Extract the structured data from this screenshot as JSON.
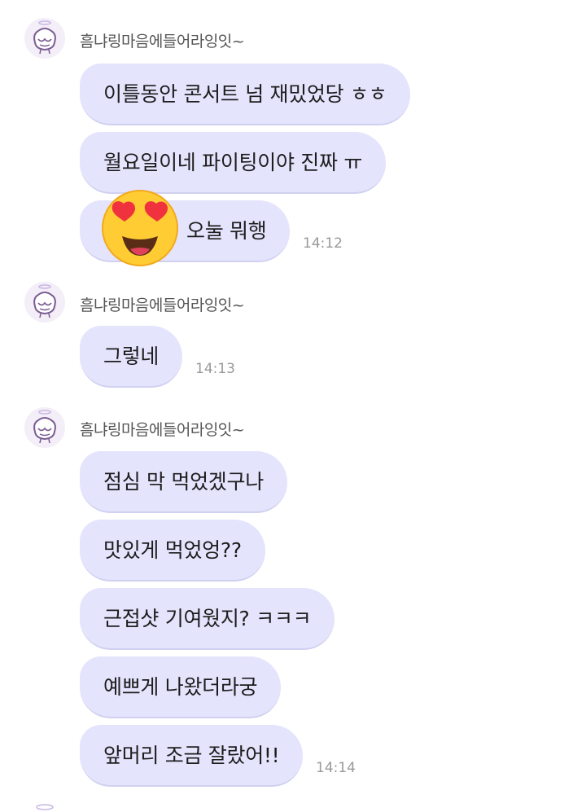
{
  "groups": [
    {
      "sender": "흠냐링마음에들어라잉잇~",
      "messages": [
        "이틀동안 콘서트 넘 재밌었당 ㅎㅎ",
        "월요일이네 파이팅이야 진짜 ㅠ",
        "오눌 뭐행"
      ],
      "time": "14:12"
    },
    {
      "sender": "흠냐링마음에들어라잉잇~",
      "messages": [
        "그렇네"
      ],
      "time": "14:13"
    },
    {
      "sender": "흠냐링마음에들어라잉잇~",
      "messages": [
        "점심 막 먹었겠구나",
        "맛있게 먹었엉??",
        "근접샷 기여웠지? ㅋㅋㅋ",
        "예쁘게 나왔더라궁",
        "앞머리 조금 잘랐어!!"
      ],
      "time": "14:14"
    }
  ],
  "emoji_overlay": "heart-eyes-emoji",
  "colors": {
    "bubble": "#e4e4fd",
    "bubble_edge": "#d0d0f0",
    "text": "#1d1d1d",
    "sender": "#555555",
    "time": "#9a9a9a",
    "emoji_face": "#ffcc33",
    "emoji_heart": "#f0313e"
  }
}
